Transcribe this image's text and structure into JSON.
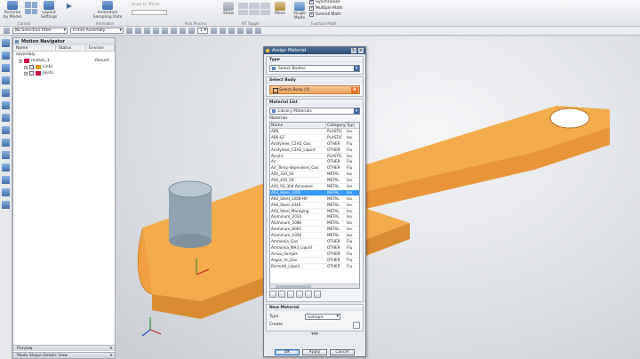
{
  "ribbon": {
    "rename_by_model_label": "Rename by Model",
    "layout_settings_label": "Layout Settings",
    "animation_sampling_rate_label": "Animation Sampling Rate",
    "show_label": "Show",
    "snap_to_mirror_label": "Snap to Mirror",
    "single_mode_label": "Single Mode",
    "move_label": "Move",
    "synchronize_label": "Synchronize",
    "multiple_math_label": "Multiple Math",
    "overall_math_label": "Overall Math",
    "group_labels": [
      "Control",
      "Animation",
      "Post Process",
      "NT Toggle",
      "Function Math"
    ]
  },
  "selection_bar": {
    "filter_value": "No Selection Filter",
    "scope_value": "Entire Assembly",
    "count_value": "1"
  },
  "navigator": {
    "title": "Motion Navigator",
    "columns": [
      "Name",
      "Status",
      "Environ"
    ],
    "rows": [
      {
        "name": "assembly",
        "status": "",
        "env": ""
      },
      {
        "name": "motion_1",
        "status": "",
        "env": "Recurd"
      },
      {
        "name": "Links",
        "status": "",
        "env": ""
      },
      {
        "name": "Joints",
        "status": "",
        "env": ""
      }
    ],
    "preview_label": "Preview",
    "mode_shape_label": "Mode Shape Details View"
  },
  "dialog": {
    "title": "Assign Material",
    "type_section": "Type",
    "type_value": "Select Bodies",
    "select_body_section": "Select Body",
    "select_body_value": "Select Body (0)",
    "material_list_section": "Material List",
    "material_list_value": "Library Materials",
    "materials_label": "Materials",
    "columns": [
      "Name",
      "Category",
      "Type"
    ],
    "materials": [
      {
        "name": "ABS",
        "cat": "PLASTIC",
        "type": "Iso"
      },
      {
        "name": "ABS-GF",
        "cat": "PLASTIC",
        "type": "Iso"
      },
      {
        "name": "Acetylene_C2H2_Gas",
        "cat": "OTHER",
        "type": "Flu"
      },
      {
        "name": "Acetylene_C2H2_Liquid",
        "cat": "OTHER",
        "type": "Flu"
      },
      {
        "name": "Acrylic",
        "cat": "PLASTIC",
        "type": "Iso"
      },
      {
        "name": "Air",
        "cat": "OTHER",
        "type": "Flu"
      },
      {
        "name": "Air_Temp-dependent_Gas",
        "cat": "OTHER",
        "type": "Flu"
      },
      {
        "name": "AISI_310_SS",
        "cat": "METAL",
        "type": "Iso"
      },
      {
        "name": "AISI_410_SS",
        "cat": "METAL",
        "type": "Iso"
      },
      {
        "name": "AISI_SS_304-Annealed",
        "cat": "METAL",
        "type": "Iso"
      },
      {
        "name": "AISI_Steel_1005",
        "cat": "METAL",
        "type": "Iso"
      },
      {
        "name": "AISI_Steel_1008-HR",
        "cat": "METAL",
        "type": "Iso"
      },
      {
        "name": "AISI_Steel_4340",
        "cat": "METAL",
        "type": "Iso"
      },
      {
        "name": "AISI_Steel_Maraging",
        "cat": "METAL",
        "type": "Iso"
      },
      {
        "name": "Aluminum_2014",
        "cat": "METAL",
        "type": "Iso"
      },
      {
        "name": "Aluminum_5086",
        "cat": "METAL",
        "type": "Iso"
      },
      {
        "name": "Aluminum_6061",
        "cat": "METAL",
        "type": "Iso"
      },
      {
        "name": "Aluminum_A356",
        "cat": "METAL",
        "type": "Iso"
      },
      {
        "name": "Ammonia_Gas",
        "cat": "OTHER",
        "type": "Flu"
      },
      {
        "name": "Ammonia_NH3_Liquid",
        "cat": "OTHER",
        "type": "Flu"
      },
      {
        "name": "Amou_Sample",
        "cat": "OTHER",
        "type": "Flu"
      },
      {
        "name": "Argon_Ar_Gas",
        "cat": "OTHER",
        "type": "Flu"
      },
      {
        "name": "Bismuth_Liquid",
        "cat": "OTHER",
        "type": "Flu"
      }
    ],
    "selected_index": 10,
    "new_material_section": "New Material",
    "type_label": "Type",
    "type_select_value": "Isotropic",
    "create_label": "Create",
    "ok_label": "OK",
    "apply_label": "Apply",
    "cancel_label": "Cancel"
  },
  "colors": {
    "part_orange": "#f2a642",
    "cylinder": "#9fb2be",
    "selection_blue": "#3399ff",
    "accent_orange": "#e8742c"
  }
}
